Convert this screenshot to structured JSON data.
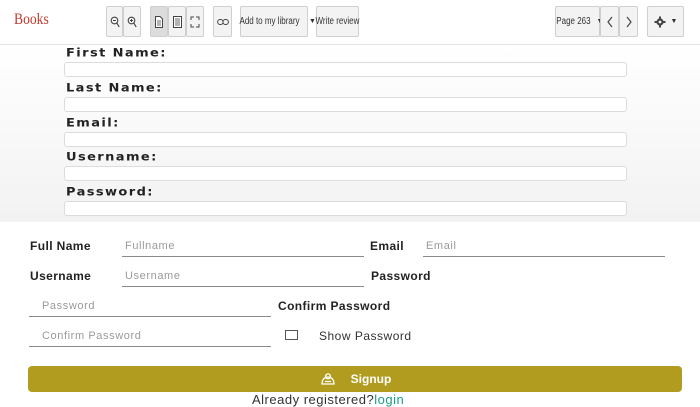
{
  "toolbar": {
    "brand": "Books",
    "add_library": "Add to my library",
    "write_review": "Write review",
    "page": "Page 263"
  },
  "upper_form": {
    "first_name": "First Name:",
    "last_name": "Last Name:",
    "email": "Email:",
    "username": "Username:",
    "password": "Password:"
  },
  "form": {
    "full_name_label": "Full Name",
    "full_name_placeholder": "Fullname",
    "email_label": "Email",
    "email_placeholder": "Email",
    "username_label": "Username",
    "username_placeholder": "Username",
    "password_label": "Password",
    "password_placeholder": "Password",
    "confirm_label": "Confirm Password",
    "confirm_placeholder": "Confirm Password",
    "show_password": "Show Password",
    "signup": "Signup",
    "already": "Already registered?",
    "login": "login"
  },
  "colors": {
    "brand": "#c0392b",
    "signup_button": "#b29c1f",
    "login_link": "#1a9c8a"
  },
  "icons": [
    "zoom-out-icon",
    "zoom-in-icon",
    "single-page-icon",
    "text-view-icon",
    "fullscreen-icon",
    "link-icon",
    "chevron-left-icon",
    "chevron-right-icon",
    "gear-icon",
    "user-icon"
  ]
}
